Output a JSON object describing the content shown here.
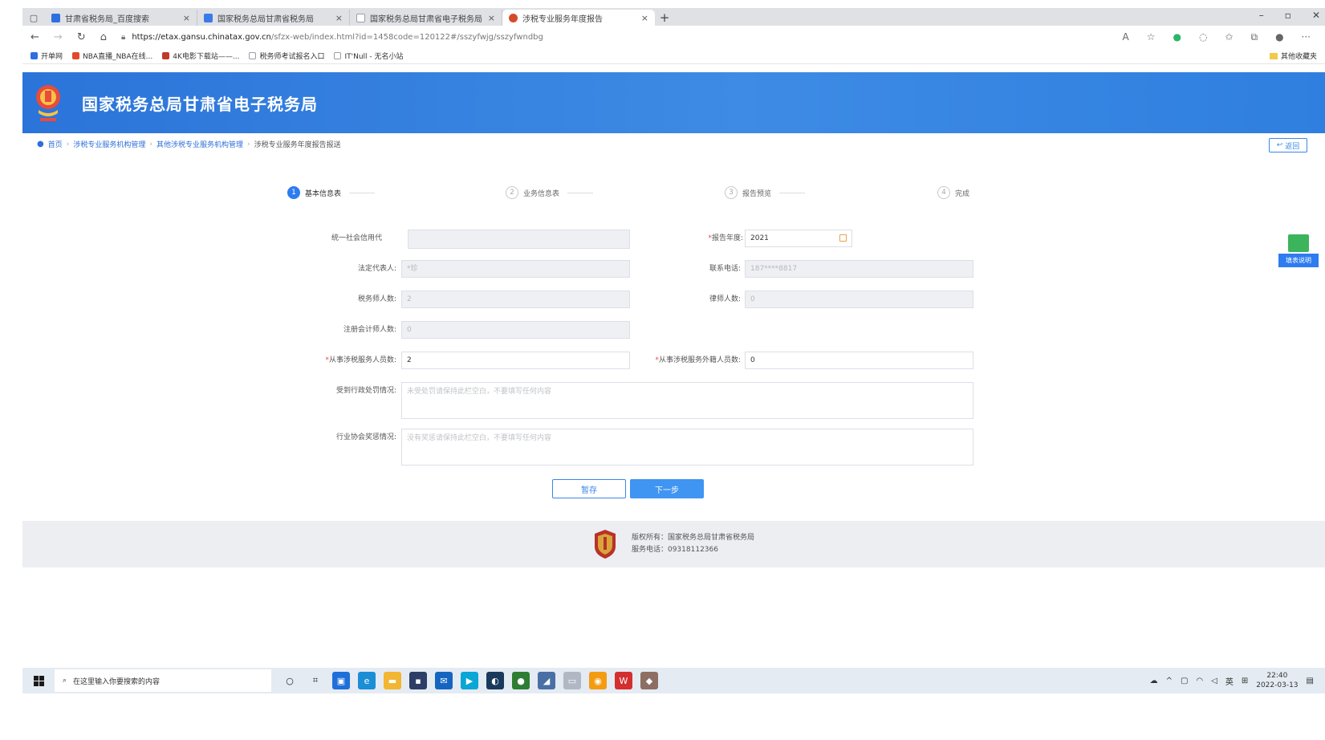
{
  "browser": {
    "tabs": [
      {
        "label": "甘肃省税务局_百度搜索",
        "color": "#2f6fe0",
        "active": false
      },
      {
        "label": "国家税务总局甘肃省税务局",
        "color": "#3b7be8",
        "active": false
      },
      {
        "label": "国家税务总局甘肃省电子税务局",
        "color": "#9aa0a6",
        "active": false
      },
      {
        "label": "涉税专业服务年度报告",
        "color": "#d44b2a",
        "active": true
      }
    ],
    "url_host": "https://etax.gansu.chinatax.gov.cn",
    "url_path": "/sfzx-web/index.html?id=1458code=120122#/sszyfwjg/sszyfwndbg",
    "bookmarks": [
      {
        "label": "开单网",
        "color": "#2f6fe0"
      },
      {
        "label": "NBA直播_NBA在线...",
        "color": "#e24b2a"
      },
      {
        "label": "4K电影下载站——...",
        "color": "#c0392b"
      },
      {
        "label": "税务师考试报名入口",
        "color": "#9aa0a6"
      },
      {
        "label": "IT'Null - 无名小站",
        "color": "#9aa0a6"
      }
    ],
    "other_bookmarks": "其他收藏夹"
  },
  "site": {
    "title": "国家税务总局甘肃省电子税务局",
    "breadcrumb": [
      "首页",
      "涉税专业服务机构管理",
      "其他涉税专业服务机构管理",
      "涉税专业服务年度报告报送"
    ],
    "back_label": "返回"
  },
  "steps": [
    {
      "num": "1",
      "label": "基本信息表",
      "active": true
    },
    {
      "num": "2",
      "label": "业务信息表",
      "active": false
    },
    {
      "num": "3",
      "label": "报告预览",
      "active": false
    },
    {
      "num": "4",
      "label": "完成",
      "active": false
    }
  ],
  "form": {
    "credit_code": {
      "label": "统一社会信用代",
      "value": ""
    },
    "report_year": {
      "label": "报告年度:",
      "value": "2021",
      "required": true
    },
    "legal_rep": {
      "label": "法定代表人:",
      "value": "*珍"
    },
    "contact_phone": {
      "label": "联系电话:",
      "value": "187****8817"
    },
    "tax_agent_count": {
      "label": "税务师人数:",
      "value": "2"
    },
    "lawyer_count": {
      "label": "律师人数:",
      "value": "0"
    },
    "cpa_count": {
      "label": "注册会计师人数:",
      "value": "0"
    },
    "service_staff": {
      "label": "从事涉税服务人员数:",
      "value": "2",
      "required": true
    },
    "foreign_staff": {
      "label": "从事涉税服务外籍人员数:",
      "value": "0",
      "required": true
    },
    "admin_penalty": {
      "label": "受到行政处罚情况:",
      "placeholder": "未受处罚请保持此栏空白，不要填写任何内容"
    },
    "industry_reward": {
      "label": "行业协会奖惩情况:",
      "placeholder": "没有奖惩请保持此栏空白，不要填写任何内容"
    }
  },
  "buttons": {
    "save": "暂存",
    "next": "下一步"
  },
  "float_help": "填表说明",
  "footer": {
    "copyright": "版权所有：国家税务总局甘肃省税务局",
    "phone": "服务电话：09318112366"
  },
  "taskbar": {
    "search_placeholder": "在这里输入你要搜索的内容",
    "time": "22:40",
    "date": "2022-03-13",
    "lang": "英"
  }
}
